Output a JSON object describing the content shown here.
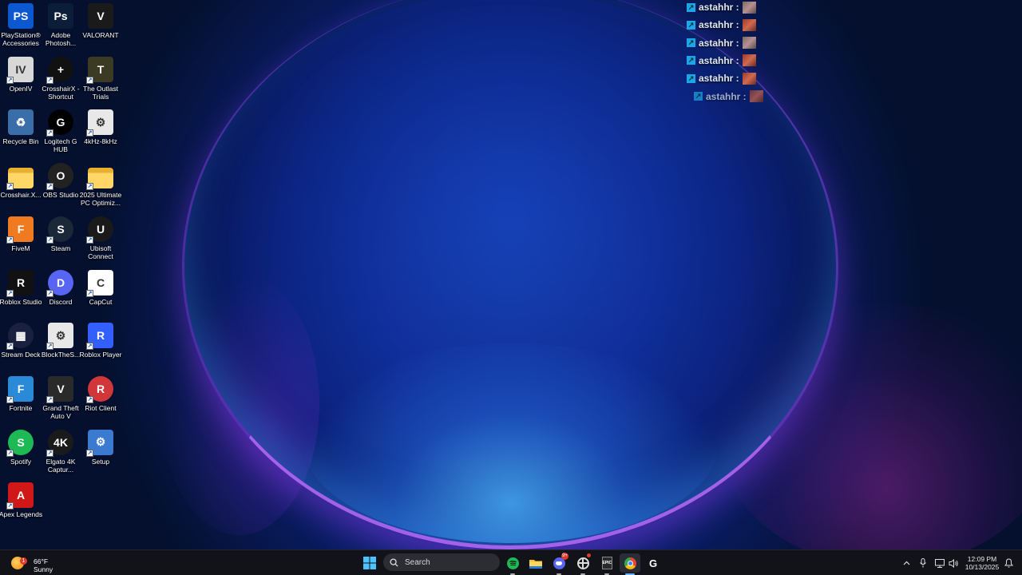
{
  "desktop": {
    "icons": [
      {
        "label": "PlayStation® Accessories",
        "icon": "playstation-icon",
        "color": "#0b58d1"
      },
      {
        "label": "Adobe Photosh...",
        "icon": "photoshop-icon",
        "color": "#0a1e3a"
      },
      {
        "label": "VALORANT",
        "icon": "valorant-icon",
        "color": "#1a1a1a"
      },
      {
        "label": "OpenIV",
        "icon": "openiv-icon",
        "color": "#d8d8d8"
      },
      {
        "label": "CrosshairX - Shortcut",
        "icon": "crosshairx-icon",
        "color": "#111111"
      },
      {
        "label": "The Outlast Trials",
        "icon": "outlast-trials-icon",
        "color": "#3b3a22"
      },
      {
        "label": "Recycle Bin",
        "icon": "recycle-bin-icon",
        "color": "#3a6ea8"
      },
      {
        "label": "Logitech G HUB",
        "icon": "logitech-g-hub-icon",
        "color": "#000000"
      },
      {
        "label": "4kHz-8kHz",
        "icon": "settings-file-icon",
        "color": "#e8e8e8"
      },
      {
        "label": "Crosshair.X...",
        "icon": "folder-icon",
        "color": "#f0c040"
      },
      {
        "label": "OBS Studio",
        "icon": "obs-studio-icon",
        "color": "#222222"
      },
      {
        "label": "2025 Ultimate PC Optimiz...",
        "icon": "folder-icon",
        "color": "#f0c040"
      },
      {
        "label": "FiveM",
        "icon": "fivem-icon",
        "color": "#f07a20"
      },
      {
        "label": "Steam",
        "icon": "steam-icon",
        "color": "#1b2838"
      },
      {
        "label": "Ubisoft Connect",
        "icon": "ubisoft-connect-icon",
        "color": "#1a1a1a"
      },
      {
        "label": "Roblox Studio",
        "icon": "roblox-studio-icon",
        "color": "#111111"
      },
      {
        "label": "Discord",
        "icon": "discord-icon",
        "color": "#5865f2"
      },
      {
        "label": "CapCut",
        "icon": "capcut-icon",
        "color": "#ffffff"
      },
      {
        "label": "Stream Deck",
        "icon": "stream-deck-icon",
        "color": "#1a2140"
      },
      {
        "label": "BlockTheS...",
        "icon": "settings-file-icon",
        "color": "#e8e8e8"
      },
      {
        "label": "Roblox Player",
        "icon": "roblox-player-icon",
        "color": "#335fff"
      },
      {
        "label": "Fortnite",
        "icon": "fortnite-icon",
        "color": "#2a8ad8"
      },
      {
        "label": "Grand Theft Auto V",
        "icon": "gta-v-icon",
        "color": "#2a2a2a"
      },
      {
        "label": "Riot Client",
        "icon": "riot-client-icon",
        "color": "#d13639"
      },
      {
        "label": "Spotify",
        "icon": "spotify-icon",
        "color": "#1db954"
      },
      {
        "label": "Elgato 4K Captur...",
        "icon": "elgato-4k-capture-icon",
        "color": "#1a1a1a"
      },
      {
        "label": "Setup",
        "icon": "setup-icon",
        "color": "#3a7ad0"
      },
      {
        "label": "Apex Legends",
        "icon": "apex-legends-icon",
        "color": "#d01818"
      }
    ]
  },
  "feed": {
    "rows": [
      {
        "name": "astahhr :"
      },
      {
        "name": "astahhr :"
      },
      {
        "name": "astahhr :"
      },
      {
        "name": "astahhr :"
      },
      {
        "name": "astahhr :"
      },
      {
        "name": "astahhr :"
      }
    ]
  },
  "taskbar": {
    "weather": {
      "temp": "66°F",
      "condition": "Sunny",
      "badge": "1"
    },
    "search_label": "Search",
    "apps": [
      "start-icon",
      "spotify-icon",
      "file-explorer-icon",
      "discord-icon",
      "crosshairx-icon",
      "epic-games-icon",
      "chrome-icon",
      "logitech-g-hub-icon"
    ],
    "discord_badge": "9+",
    "clock": {
      "time": "12:09 PM",
      "date": "10/13/2025"
    }
  }
}
